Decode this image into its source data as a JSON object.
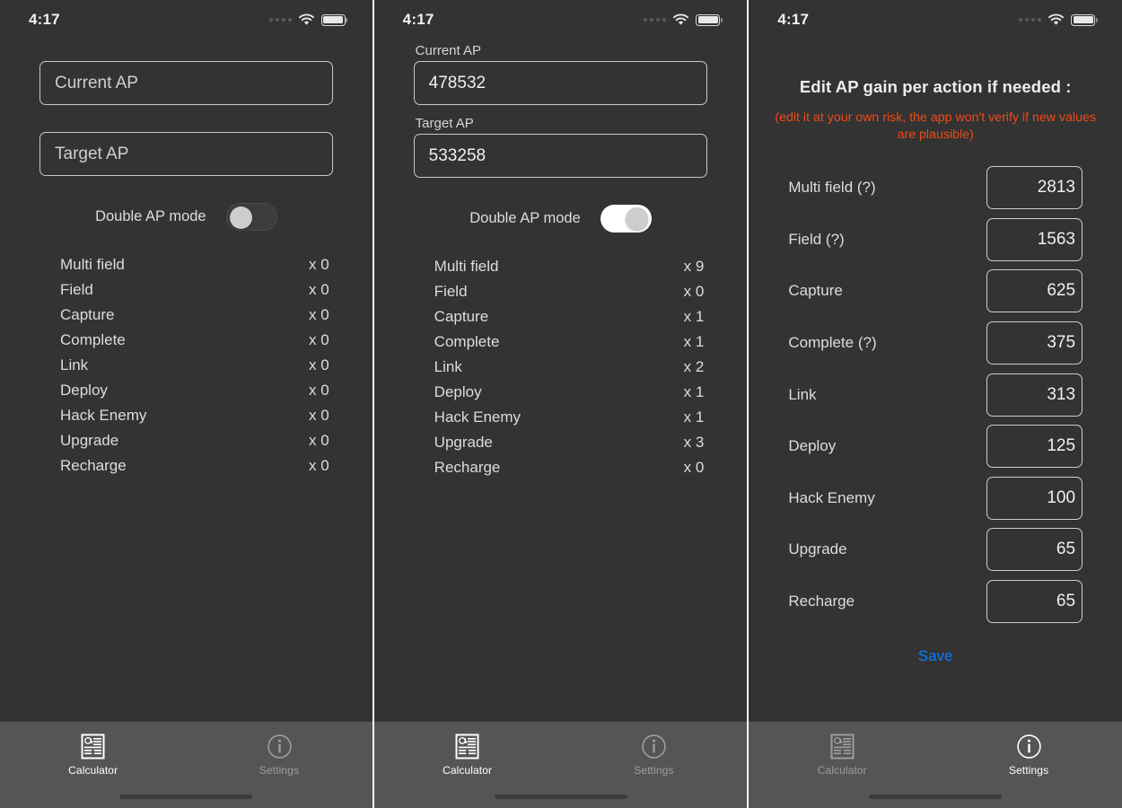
{
  "status_bar": {
    "time": "4:17",
    "icons": [
      "cellular-dots-icon",
      "wifi-icon",
      "battery-icon"
    ]
  },
  "colors": {
    "background": "#333333",
    "tab_bar": "#555555",
    "warning_text": "#f04a16",
    "save_link": "#0a7cff",
    "field_border": "#cdcdcd",
    "text_primary": "#dddddd"
  },
  "tab_bar": {
    "tabs": [
      {
        "label": "Calculator",
        "icon": "article-at-icon"
      },
      {
        "label": "Settings",
        "icon": "info-circle-icon"
      }
    ]
  },
  "screen1": {
    "current_ap": {
      "label": "Current AP",
      "placeholder": "Current AP",
      "value": ""
    },
    "target_ap": {
      "label": "Target AP",
      "placeholder": "Target AP",
      "value": ""
    },
    "toggle": {
      "label": "Double AP mode",
      "state": "off"
    },
    "actions": [
      {
        "name": "Multi field",
        "count": "x 0"
      },
      {
        "name": "Field",
        "count": "x 0"
      },
      {
        "name": "Capture",
        "count": "x 0"
      },
      {
        "name": "Complete",
        "count": "x 0"
      },
      {
        "name": "Link",
        "count": "x 0"
      },
      {
        "name": "Deploy",
        "count": "x 0"
      },
      {
        "name": "Hack Enemy",
        "count": "x 0"
      },
      {
        "name": "Upgrade",
        "count": "x 0"
      },
      {
        "name": "Recharge",
        "count": "x 0"
      }
    ],
    "active_tab": "Calculator"
  },
  "screen2": {
    "current_ap": {
      "label": "Current AP",
      "placeholder": "Current AP",
      "value": "478532"
    },
    "target_ap": {
      "label": "Target AP",
      "placeholder": "Target AP",
      "value": "533258"
    },
    "toggle": {
      "label": "Double AP mode",
      "state": "on"
    },
    "actions": [
      {
        "name": "Multi field",
        "count": "x 9"
      },
      {
        "name": "Field",
        "count": "x 0"
      },
      {
        "name": "Capture",
        "count": "x 1"
      },
      {
        "name": "Complete",
        "count": "x 1"
      },
      {
        "name": "Link",
        "count": "x 2"
      },
      {
        "name": "Deploy",
        "count": "x 1"
      },
      {
        "name": "Hack Enemy",
        "count": "x 1"
      },
      {
        "name": "Upgrade",
        "count": "x 3"
      },
      {
        "name": "Recharge",
        "count": "x 0"
      }
    ],
    "active_tab": "Calculator"
  },
  "screen3": {
    "title": "Edit AP gain per action if needed :",
    "warning": "(edit it at your own risk, the app won't verify if new values are plausible)",
    "gains": [
      {
        "name": "Multi field (?)",
        "value": "2813"
      },
      {
        "name": "Field (?)",
        "value": "1563"
      },
      {
        "name": "Capture",
        "value": "625"
      },
      {
        "name": "Complete (?)",
        "value": "375"
      },
      {
        "name": "Link",
        "value": "313"
      },
      {
        "name": "Deploy",
        "value": "125"
      },
      {
        "name": "Hack Enemy",
        "value": "100"
      },
      {
        "name": "Upgrade",
        "value": "65"
      },
      {
        "name": "Recharge",
        "value": "65"
      }
    ],
    "save_label": "Save",
    "active_tab": "Settings"
  }
}
